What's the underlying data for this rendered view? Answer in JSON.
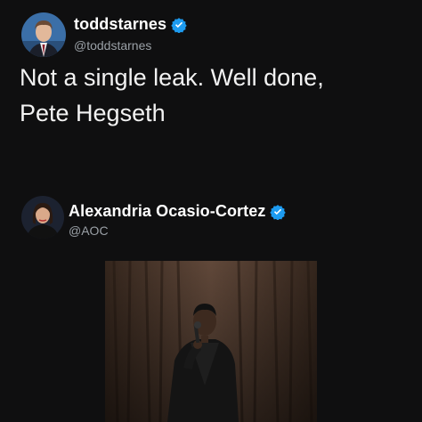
{
  "post_1": {
    "display_name": "toddstarnes",
    "handle": "@toddstarnes",
    "verified_icon": "verified-badge-icon",
    "text_line_1": "Not a single leak. Well done,",
    "text_line_2": "Pete Hegseth"
  },
  "post_2": {
    "display_name": "Alexandria Ocasio-Cortez",
    "handle": "@AOC",
    "verified_icon": "verified-badge-icon",
    "media": "video-thumbnail"
  },
  "colors": {
    "background": "#0f0f10",
    "verified_blue": "#1d9bf0",
    "handle_gray": "#9aa0a6"
  }
}
